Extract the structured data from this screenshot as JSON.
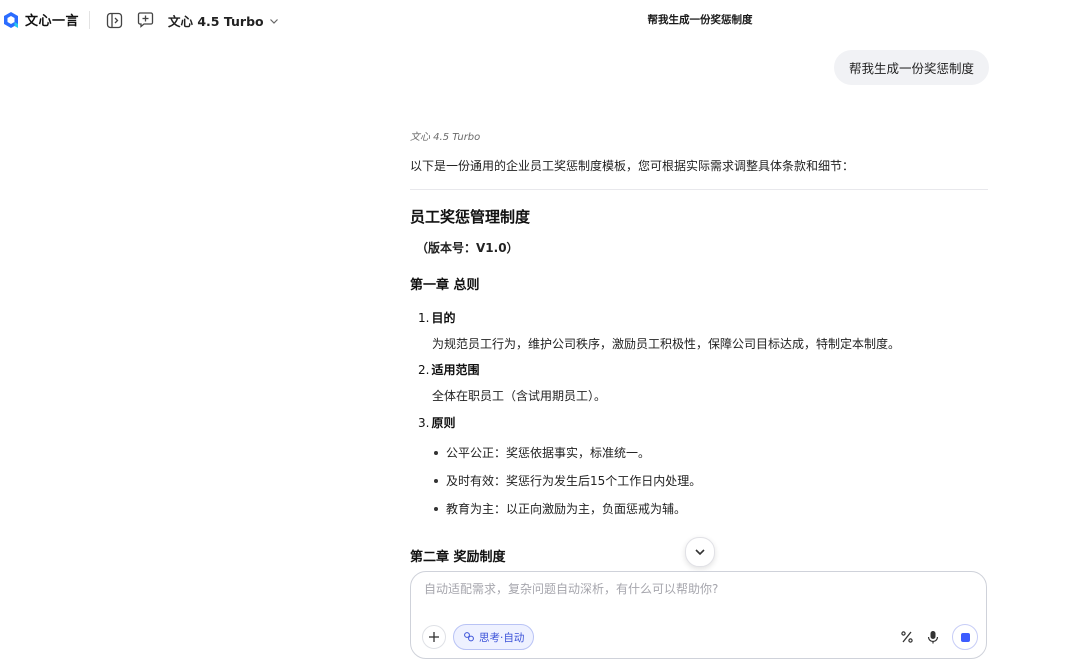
{
  "app": {
    "name": "文心一言",
    "model_label": "文心 4.5 Turbo",
    "page_title": "帮我生成一份奖惩制度"
  },
  "colors": {
    "accent": "#3d5cff",
    "bubble": "#f1f2f5",
    "chip": "#eef1ff"
  },
  "chat": {
    "user_message": "帮我生成一份奖惩制度",
    "answer": {
      "model_tag": "文心 4.5 Turbo",
      "intro": "以下是一份通用的企业员工奖惩制度模板，您可根据实际需求调整具体条款和细节：",
      "doc_title": "员工奖惩管理制度",
      "version": "（版本号：V1.0）",
      "chapter1": {
        "title": "第一章 总则",
        "items": [
          {
            "num": "1.",
            "title": "目的",
            "body": "为规范员工行为，维护公司秩序，激励员工积极性，保障公司目标达成，特制定本制度。"
          },
          {
            "num": "2.",
            "title": "适用范围",
            "body": "全体在职员工（含试用期员工）。"
          },
          {
            "num": "3.",
            "title": "原则",
            "bullets": [
              "公平公正：奖惩依据事实，标准统一。",
              "及时有效：奖惩行为发生后15个工作日内处理。",
              "教育为主：以正向激励为主，负面惩戒为辅。"
            ]
          }
        ]
      },
      "chapter2_title": "第二章 奖励制度"
    }
  },
  "input": {
    "placeholder": "自动适配需求，复杂问题自动深析，有什么可以帮助你?",
    "think_chip": "思考·自动"
  },
  "icons": {
    "logo": "wenxin-logo-icon",
    "sidebar_toggle": "sidebar-toggle-icon",
    "new_chat": "new-chat-icon",
    "model_dropdown": "chevron-down-icon",
    "scroll_down": "chevron-down-icon",
    "add": "plus-icon",
    "think": "brain-icon",
    "percent": "percent-icon",
    "voice": "microphone-icon",
    "stop": "stop-icon"
  }
}
